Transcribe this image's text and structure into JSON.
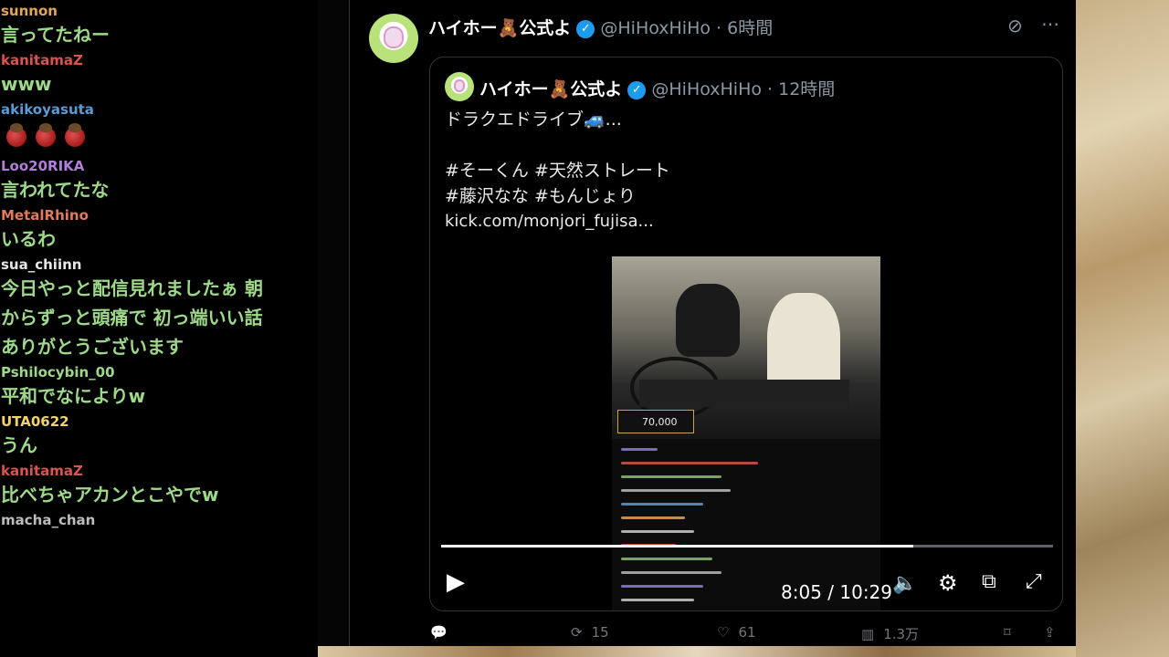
{
  "chat": {
    "messages": [
      {
        "user": "sunnon",
        "color": "#e0a75a",
        "text": [
          "言ってたねー"
        ]
      },
      {
        "user": "kanitamaZ",
        "color": "#d9534f",
        "text": [
          "www"
        ]
      },
      {
        "user": "akikoyasuta",
        "color": "#5b9bd5",
        "emoji": "apple-icon",
        "emoji_count": 3
      },
      {
        "user": "Loo20RIKA",
        "color": "#b07fd8",
        "text": [
          "言われてたな"
        ]
      },
      {
        "user": "MetalRhino",
        "color": "#e07a5a",
        "text": [
          "いるわ"
        ]
      },
      {
        "user": "sua_chiinn",
        "color": "#e6e6e6",
        "text": [
          "今日やっと配信見れましたぁ 朝",
          "からずっと頭痛で 初っ端いい話",
          "ありがとうございます"
        ]
      },
      {
        "user": "Pshilocybin_00",
        "color": "#9ed98a",
        "text": [
          "平和でなによりw"
        ]
      },
      {
        "user": "UTA0622",
        "color": "#f2d36b",
        "text": [
          "うん"
        ]
      },
      {
        "user": "kanitamaZ",
        "color": "#d9534f",
        "text": [
          "比べちゃアカンとこやでw"
        ]
      },
      {
        "user": "macha_chan",
        "color": "#bcbcbc",
        "text": []
      }
    ]
  },
  "tweet": {
    "name": "ハイホー🧸公式よ",
    "handle": "@HiHoxHiHo",
    "time": "· 6時間",
    "quote": {
      "name": "ハイホー🧸公式よ",
      "handle": "@HiHoxHiHo",
      "time": "· 12時間",
      "line1": "ドラクエドライブ🚙...",
      "line2": "#そーくん #天然ストレート",
      "line3": "#藤沢なな #もんじょり",
      "line4": "kick.com/monjori_fujisa..."
    },
    "video": {
      "score": "70,000",
      "time": "8:05 / 10:29",
      "progress": 0.772
    },
    "actions": {
      "retweets": "15",
      "likes": "61",
      "views": "1.3万"
    }
  }
}
